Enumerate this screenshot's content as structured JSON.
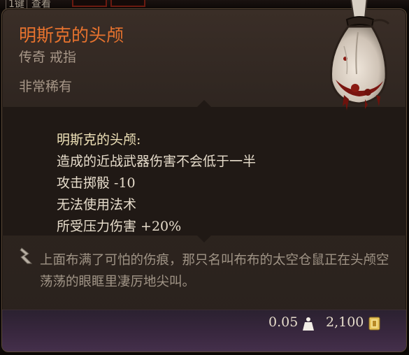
{
  "hotkey": {
    "key": "1键",
    "label": "查看"
  },
  "item": {
    "name": "明斯克的头颅",
    "subtitle": "传奇 戒指",
    "rarity": "非常稀有"
  },
  "effects": {
    "header": "明斯克的头颅:",
    "lines": [
      "造成的近战武器伤害不会低于一半",
      "攻击掷骰 -10",
      "无法使用法术",
      "所受压力伤害 +20%"
    ]
  },
  "flavor_text": "上面布满了可怕的伤痕，那只名叫布布的太空仓鼠正在头颅空荡荡的眼眶里凄厉地尖叫。",
  "footer": {
    "weight": "0.05",
    "weight_icon": "weight-icon",
    "value": "2,100",
    "value_icon": "gold-coin-icon"
  },
  "colors": {
    "title": "#e8732e",
    "subtitle": "#a79788",
    "effect_text": "#e6dccb",
    "flavor_text": "#a09486",
    "panel_bg": "#2e2520",
    "footer_bg": "#3a2840"
  }
}
